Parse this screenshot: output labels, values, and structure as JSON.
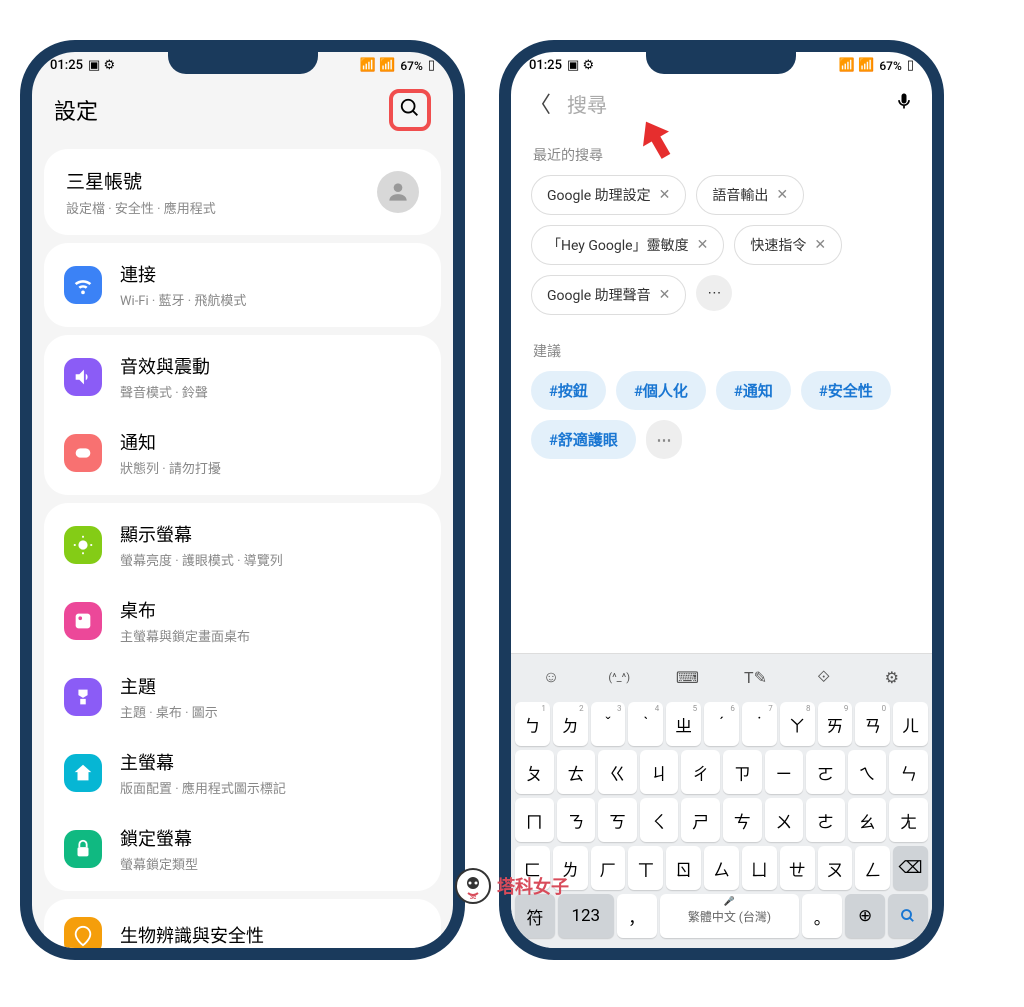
{
  "status": {
    "time": "01:25",
    "battery": "67%"
  },
  "left": {
    "header_title": "設定",
    "account": {
      "title": "三星帳號",
      "sub": "設定檔 · 安全性 · 應用程式"
    },
    "groups": [
      {
        "items": [
          {
            "icon": "wifi-icon",
            "color": "#3b82f6",
            "title": "連接",
            "sub": "Wi-Fi · 藍牙 · 飛航模式"
          }
        ]
      },
      {
        "items": [
          {
            "icon": "sound-icon",
            "color": "#8b5cf6",
            "title": "音效與震動",
            "sub": "聲音模式 · 鈴聲"
          },
          {
            "icon": "notification-icon",
            "color": "#f87171",
            "title": "通知",
            "sub": "狀態列 · 請勿打擾"
          }
        ]
      },
      {
        "items": [
          {
            "icon": "display-icon",
            "color": "#84cc16",
            "title": "顯示螢幕",
            "sub": "螢幕亮度 · 護眼模式 · 導覽列"
          },
          {
            "icon": "wallpaper-icon",
            "color": "#ec4899",
            "title": "桌布",
            "sub": "主螢幕與鎖定畫面桌布"
          },
          {
            "icon": "theme-icon",
            "color": "#8b5cf6",
            "title": "主題",
            "sub": "主題 · 桌布 · 圖示"
          },
          {
            "icon": "home-icon",
            "color": "#06b6d4",
            "title": "主螢幕",
            "sub": "版面配置 · 應用程式圖示標記"
          },
          {
            "icon": "lock-icon",
            "color": "#10b981",
            "title": "鎖定螢幕",
            "sub": "螢幕鎖定類型"
          }
        ]
      },
      {
        "items": [
          {
            "icon": "biometric-icon",
            "color": "#f59e0b",
            "title": "生物辨識與安全性",
            "sub": ""
          }
        ]
      }
    ]
  },
  "right": {
    "search_placeholder": "搜尋",
    "recent_label": "最近的搜尋",
    "recent": [
      "Google 助理設定",
      "語音輸出",
      "「Hey Google」靈敏度",
      "快速指令",
      "Google 助理聲音"
    ],
    "suggest_label": "建議",
    "suggest": [
      "#按鈕",
      "#個人化",
      "#通知",
      "#安全性",
      "#舒適護眼"
    ],
    "keyboard": {
      "rows": [
        [
          "ㄅ",
          "ㄉ",
          "ˇ",
          "ˋ",
          "ㄓ",
          "ˊ",
          "˙",
          "ㄚ",
          "ㄞ",
          "ㄢ",
          "ㄦ"
        ],
        [
          "ㄆ",
          "ㄊ",
          "ㄍ",
          "ㄐ",
          "ㄔ",
          "ㄗ",
          "ㄧ",
          "ㄛ",
          "ㄟ",
          "ㄣ"
        ],
        [
          "ㄇ",
          "ㄋ",
          "ㄎ",
          "ㄑ",
          "ㄕ",
          "ㄘ",
          "ㄨ",
          "ㄜ",
          "ㄠ",
          "ㄤ"
        ],
        [
          "ㄈ",
          "ㄌ",
          "ㄏ",
          "ㄒ",
          "ㄖ",
          "ㄙ",
          "ㄩ",
          "ㄝ",
          "ㄡ",
          "ㄥ"
        ]
      ],
      "sym": "符",
      "num": "123",
      "space": "繁體中文 (台灣)"
    }
  },
  "watermark": "塔科女子"
}
